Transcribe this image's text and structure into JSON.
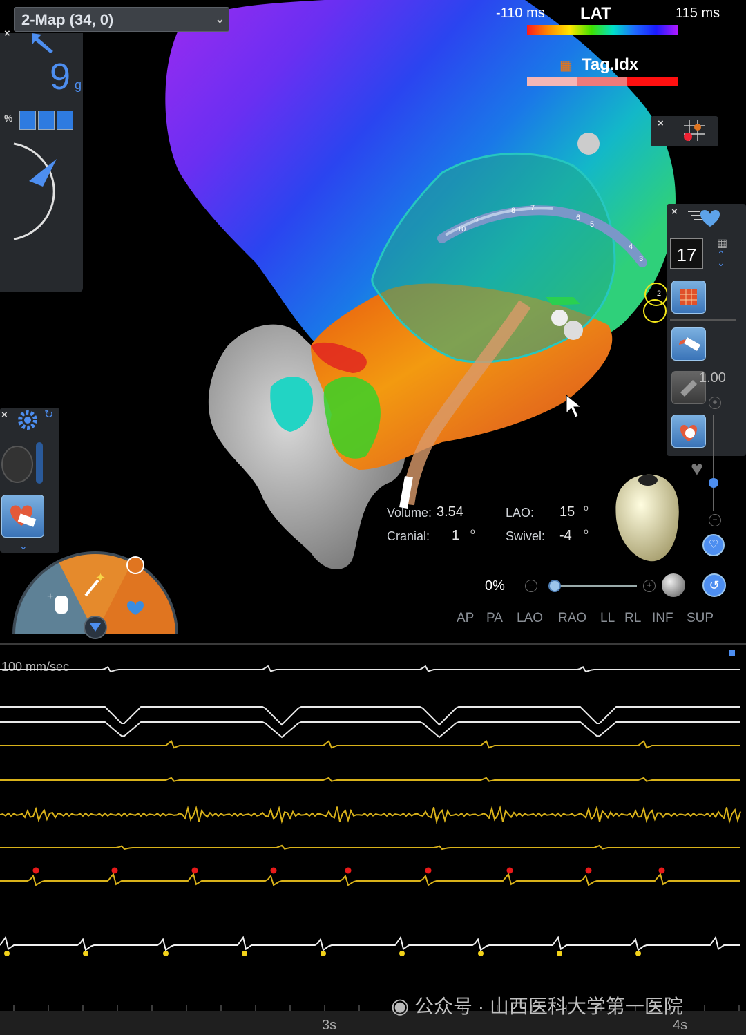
{
  "map_view": {
    "map_selector": "2-Map (34, 0)",
    "point_count": "9",
    "point_count_unit": "g",
    "percent_label": "%",
    "lat_legend": {
      "min_label": "-110 ms",
      "title": "LAT",
      "max_label": "115 ms"
    },
    "tag_legend": {
      "title": "Tag.Idx",
      "colors": [
        "#f4b6b6",
        "#ee7a7a",
        "#ff1010"
      ]
    },
    "electrode_counter": "17",
    "scale_value": "1.00",
    "volume": {
      "label": "Volume:",
      "value": "3.54"
    },
    "lao": {
      "label": "LAO:",
      "value": "15",
      "unit": "o"
    },
    "cranial": {
      "label": "Cranial:",
      "value": "1",
      "unit": "o"
    },
    "swivel": {
      "label": "Swivel:",
      "value": "-4",
      "unit": "o"
    },
    "transparency": "0%",
    "view_buttons": [
      "AP",
      "PA",
      "LAO",
      "RAO",
      "LL",
      "RL",
      "INF",
      "SUP"
    ],
    "catheter_labels": [
      "10",
      "9",
      "8",
      "7",
      "6",
      "5",
      "4",
      "3",
      "2"
    ],
    "icons": {
      "mode_tool": "magic-wand-icon",
      "point_tool": "hand-pointer-icon",
      "heart_tool": "heart-icon",
      "settings": "gear-icon"
    }
  },
  "ecg_view": {
    "speed_label": "100 mm/sec",
    "time_labels": [
      "3s",
      "4s"
    ],
    "watermark": "公众号 · 山西医科大学第一医院"
  }
}
